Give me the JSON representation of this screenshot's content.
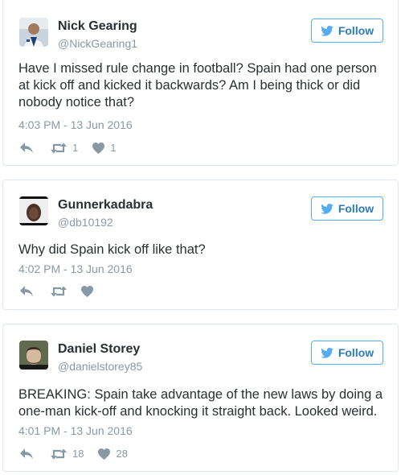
{
  "colors": {
    "follow_blue": "#55acee",
    "text": "#292f33",
    "muted": "#8899a6",
    "border": "#e1e8ed"
  },
  "tweets": [
    {
      "name": "Nick Gearing",
      "handle": "@NickGearing1",
      "follow_label": "Follow",
      "text": "Have I missed rule change in football? Spain had one person at kick off and kicked it backwards? Am I being thick or did nobody notice that?",
      "timestamp": "4:03 PM - 13 Jun 2016",
      "retweets": "1",
      "likes": "1"
    },
    {
      "name": "Gunnerkadabra",
      "handle": "@db10192",
      "follow_label": "Follow",
      "text": "Why did Spain kick off like that?",
      "timestamp": "4:02 PM - 13 Jun 2016",
      "retweets": "",
      "likes": ""
    },
    {
      "name": "Daniel Storey",
      "handle": "@danielstorey85",
      "follow_label": "Follow",
      "text": "BREAKING: Spain take advantage of the new laws by doing a one-man kick-off and knocking it straight back. Looked weird.",
      "timestamp": "4:01 PM - 13 Jun 2016",
      "retweets": "18",
      "likes": "28"
    }
  ],
  "icons": {
    "follow": "twitter-bird-icon",
    "reply": "reply-icon",
    "retweet": "retweet-icon",
    "like": "heart-icon"
  }
}
